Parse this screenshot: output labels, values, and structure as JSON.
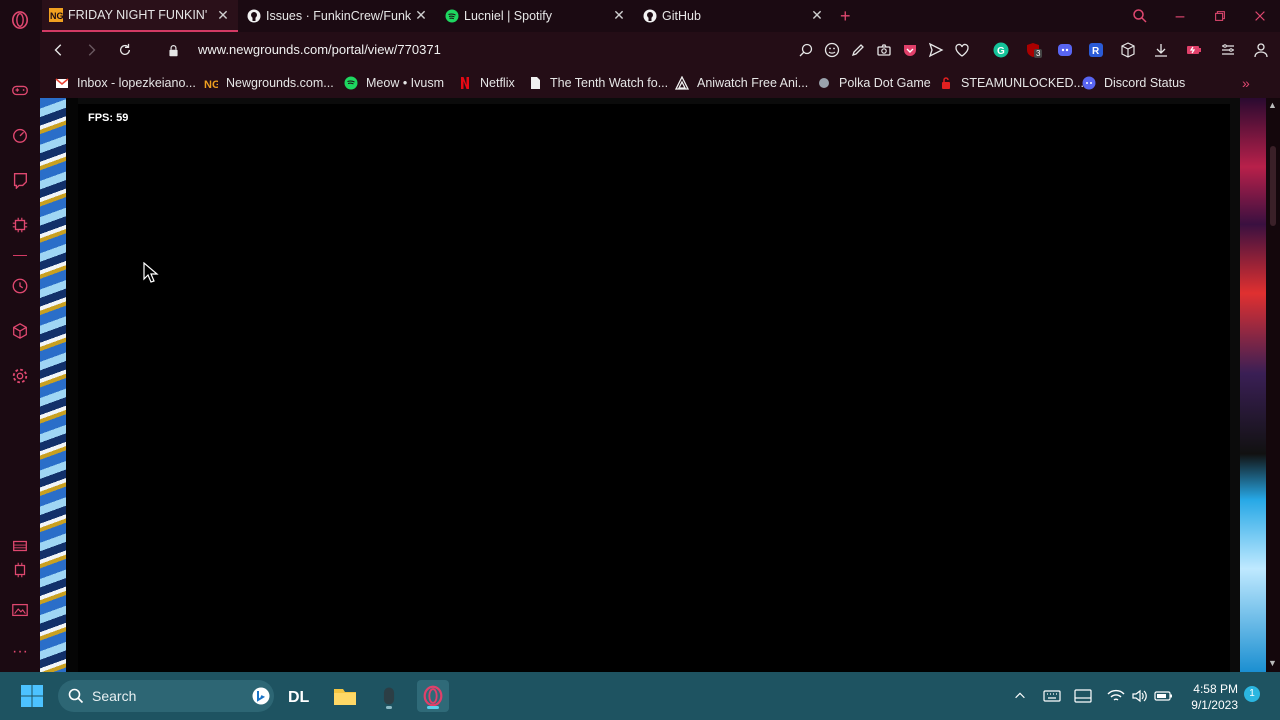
{
  "browser": {
    "tabs": [
      {
        "title": "FRIDAY NIGHT FUNKIN'",
        "favicon": "newgrounds-icon",
        "active": true
      },
      {
        "title": "Issues · FunkinCrew/Funkin",
        "favicon": "github-icon",
        "active": false
      },
      {
        "title": "Lucniel | Spotify",
        "favicon": "spotify-icon",
        "active": false
      },
      {
        "title": "GitHub",
        "favicon": "github-icon",
        "active": false
      }
    ],
    "new_tab_label": "+",
    "url": "www.newgrounds.com/portal/view/770371",
    "extension_badge": "3",
    "bookmarks": [
      {
        "label": "Inbox - lopezkeiano...",
        "icon": "gmail-icon"
      },
      {
        "label": "Newgrounds.com...",
        "icon": "newgrounds-icon"
      },
      {
        "label": "Meow • Ivusm",
        "icon": "spotify-icon"
      },
      {
        "label": "Netflix",
        "icon": "netflix-icon"
      },
      {
        "label": "The Tenth Watch fo...",
        "icon": "page-icon"
      },
      {
        "label": "Aniwatch Free Ani...",
        "icon": "aniwatch-icon"
      },
      {
        "label": "Polka Dot Game",
        "icon": "dot-icon"
      },
      {
        "label": "STEAMUNLOCKED...",
        "icon": "steamunlocked-icon"
      },
      {
        "label": "Discord Status",
        "icon": "discord-icon"
      }
    ]
  },
  "game": {
    "fps_text": "FPS: 59"
  },
  "taskbar": {
    "search_label": "Search",
    "time": "4:58 PM",
    "date": "9/1/2023",
    "notification_count": "1"
  },
  "colors": {
    "accent": "#d33a64",
    "chrome_bg": "#1b0a12",
    "taskbar_bg": "#1e5361"
  }
}
